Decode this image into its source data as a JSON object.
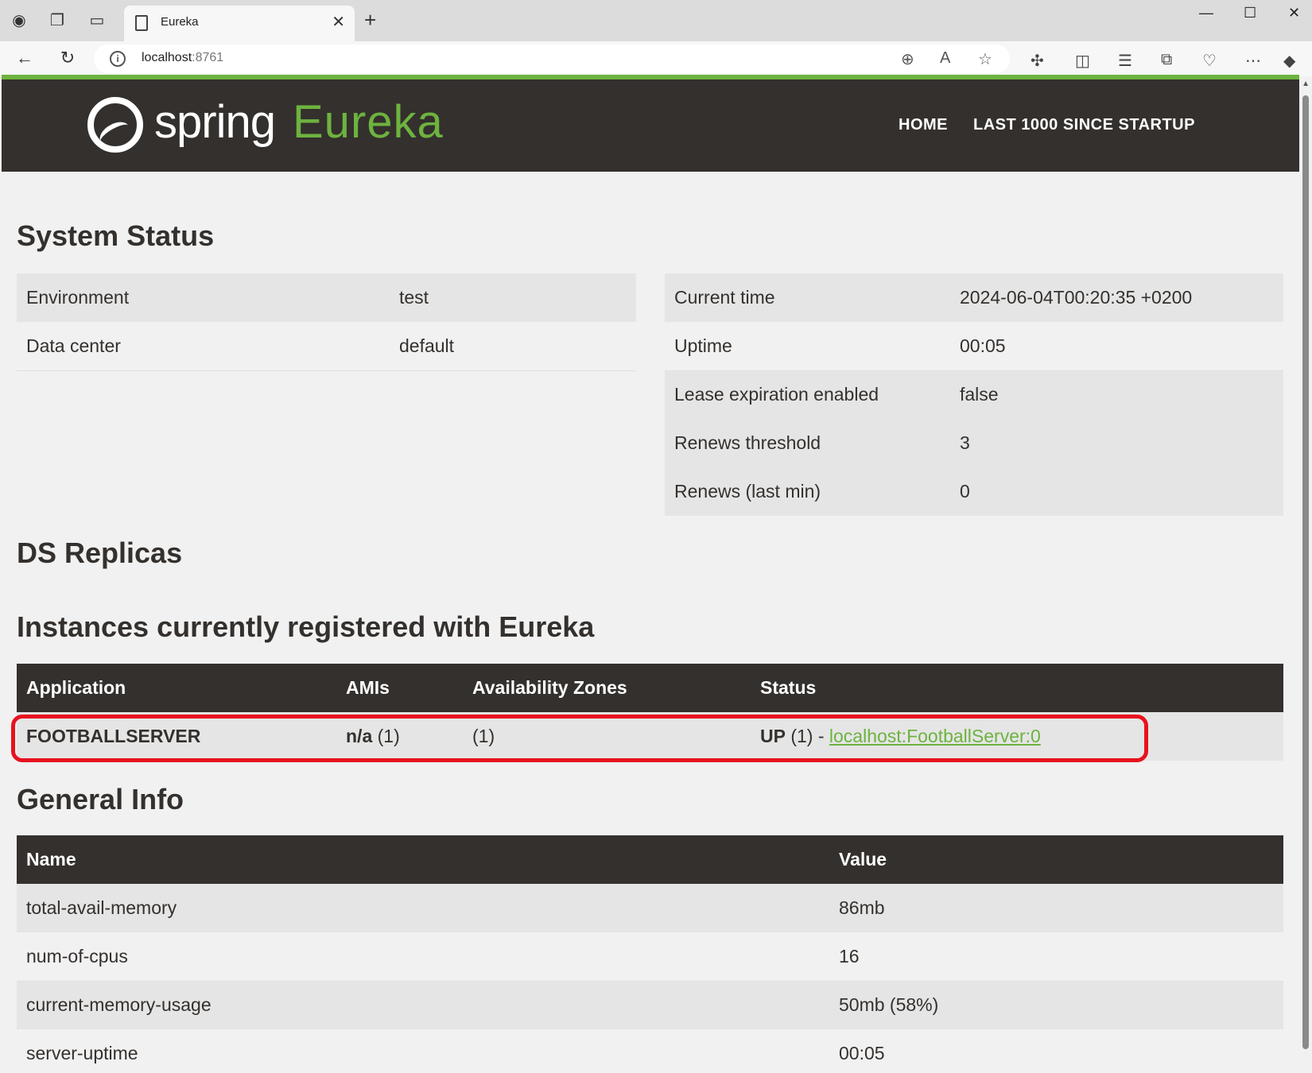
{
  "browser": {
    "tab_title": "Eureka",
    "tab_close": "✕",
    "new_tab": "+",
    "url_host": "localhost",
    "url_port": ":8761"
  },
  "header": {
    "brand_spring": "spring",
    "brand_eureka": "Eureka",
    "nav": [
      "HOME",
      "LAST 1000 SINCE STARTUP"
    ]
  },
  "system_status": {
    "title": "System Status",
    "left": [
      {
        "label": "Environment",
        "value": "test"
      },
      {
        "label": "Data center",
        "value": "default"
      }
    ],
    "right": [
      {
        "label": "Current time",
        "value": "2024-06-04T00:20:35 +0200"
      },
      {
        "label": "Uptime",
        "value": "00:05"
      },
      {
        "label": "Lease expiration enabled",
        "value": "false"
      },
      {
        "label": "Renews threshold",
        "value": "3"
      },
      {
        "label": "Renews (last min)",
        "value": "0"
      }
    ]
  },
  "ds_replicas": {
    "title": "DS Replicas"
  },
  "instances": {
    "title": "Instances currently registered with Eureka",
    "headers": [
      "Application",
      "AMIs",
      "Availability Zones",
      "Status"
    ],
    "rows": [
      {
        "application": "FOOTBALLSERVER",
        "amis_bold": "n/a",
        "amis_count": "(1)",
        "zones": "(1)",
        "status_bold": "UP",
        "status_rest": "(1) -",
        "status_link": "localhost:FootballServer:0"
      }
    ]
  },
  "general_info": {
    "title": "General Info",
    "headers": [
      "Name",
      "Value"
    ],
    "rows": [
      {
        "name": "total-avail-memory",
        "value": "86mb"
      },
      {
        "name": "num-of-cpus",
        "value": "16"
      },
      {
        "name": "current-memory-usage",
        "value": "50mb (58%)"
      },
      {
        "name": "server-uptime",
        "value": "00:05"
      }
    ]
  },
  "colors": {
    "header_bg": "#34302d",
    "brand_green": "#6db33f",
    "highlight_red": "#e8121f"
  }
}
